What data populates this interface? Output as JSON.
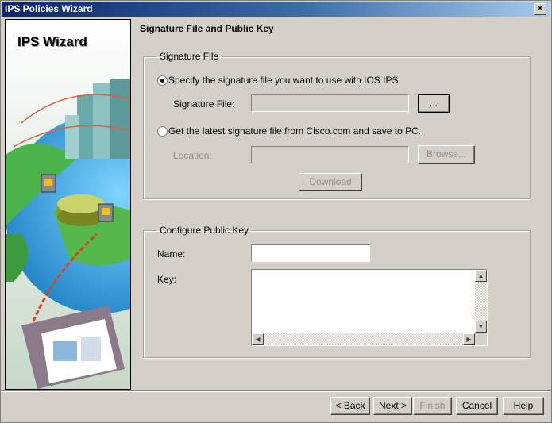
{
  "window": {
    "title": "IPS Policies Wizard"
  },
  "sidebar": {
    "title": "IPS Wizard"
  },
  "page": {
    "header": "Signature File and Public Key"
  },
  "signature_file": {
    "group_label": "Signature File",
    "option_specify": "Specify the signature file you want to use with IOS IPS.",
    "sigfile_label": "Signature File:",
    "sigfile_value": "",
    "browse_small": "...",
    "option_cisco": "Get the latest signature file from Cisco.com and save to PC.",
    "location_label": "Location:",
    "location_value": "",
    "browse_label": "Browse...",
    "download_label": "Download"
  },
  "public_key": {
    "group_label": "Configure Public Key",
    "name_label": "Name:",
    "name_value": "",
    "key_label": "Key:",
    "key_value": ""
  },
  "footer": {
    "back": "< Back",
    "next": "Next >",
    "finish": "Finish",
    "cancel": "Cancel",
    "help": "Help"
  }
}
